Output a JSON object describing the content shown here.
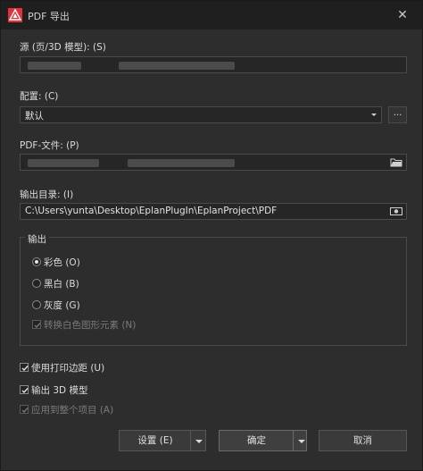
{
  "window": {
    "title": "PDF 导出",
    "close_glyph": "✕"
  },
  "source": {
    "label": "源 (页/3D 模型): (S)"
  },
  "config": {
    "label": "配置: (C)",
    "value": "默认",
    "dots_label": "..."
  },
  "pdf_file": {
    "label": "PDF-文件: (P)"
  },
  "output_dir": {
    "label": "输出目录: (I)",
    "value": "C:\\Users\\yunta\\Desktop\\EplanPlugIn\\EplanProject\\PDF"
  },
  "output_group": {
    "title": "输出",
    "options": [
      {
        "label": "彩色 (O)",
        "selected": true,
        "enabled": true
      },
      {
        "label": "黑白 (B)",
        "selected": false,
        "enabled": true
      },
      {
        "label": "灰度 (G)",
        "selected": false,
        "enabled": true
      }
    ],
    "convert_white": {
      "label": "转换白色图形元素 (N)",
      "checked": true,
      "enabled": false
    }
  },
  "checkboxes": [
    {
      "label": "使用打印边距 (U)",
      "checked": true,
      "enabled": true
    },
    {
      "label": "输出 3D 模型",
      "checked": true,
      "enabled": true
    },
    {
      "label": "应用到整个项目 (A)",
      "checked": true,
      "enabled": false
    }
  ],
  "buttons": {
    "settings": "设置 (E)",
    "ok": "确定",
    "cancel": "取消"
  },
  "icons": {
    "app": "eplan-logo-icon",
    "folder": "folder-icon",
    "browse": "browse-icon"
  },
  "colors": {
    "accent": "#e0323a",
    "background": "#2d2d2d",
    "titlebar": "#1f1f1f"
  }
}
